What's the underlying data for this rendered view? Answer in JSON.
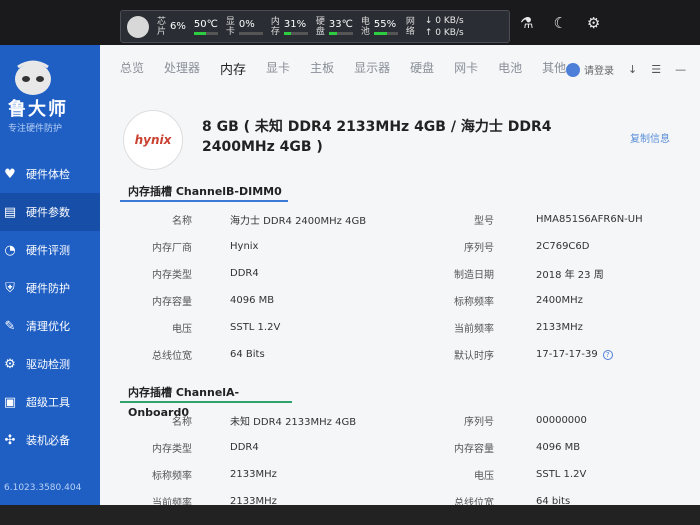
{
  "topbar": {
    "stats": [
      {
        "label_top": "芯",
        "label_bottom": "片",
        "value": "6%",
        "bar": 0.06
      },
      {
        "label_top": "",
        "label_bottom": "",
        "value": "50℃",
        "bar": 0.5
      },
      {
        "label_top": "显",
        "label_bottom": "卡",
        "value": "0%",
        "bar": 0.0
      },
      {
        "label_top": "内",
        "label_bottom": "存",
        "value": "31%",
        "bar": 0.31
      },
      {
        "label_top": "硬",
        "label_bottom": "盘",
        "value": "33℃",
        "bar": 0.33
      },
      {
        "label_top": "电",
        "label_bottom": "池",
        "value": "55%",
        "bar": 0.55
      }
    ],
    "net": {
      "label_top": "网",
      "label_bottom": "络",
      "down": "↓ 0 KB/s",
      "up": "↑ 0 KB/s"
    }
  },
  "top_icons": [
    "flask-icon",
    "moon-icon",
    "gear-icon"
  ],
  "sidebar": {
    "brand": "鲁大师",
    "slogan": "专注硬件防护",
    "items": [
      {
        "label": "硬件体检",
        "icon": "heart-icon"
      },
      {
        "label": "硬件参数",
        "icon": "list-icon"
      },
      {
        "label": "硬件评测",
        "icon": "gauge-icon"
      },
      {
        "label": "硬件防护",
        "icon": "shield-icon"
      },
      {
        "label": "清理优化",
        "icon": "broom-icon"
      },
      {
        "label": "驱动检测",
        "icon": "gear-icon"
      },
      {
        "label": "超级工具",
        "icon": "toolbox-icon"
      },
      {
        "label": "装机必备",
        "icon": "apps-icon"
      }
    ],
    "version": "6.1023.3580.404"
  },
  "tabs": [
    "总览",
    "处理器",
    "内存",
    "显卡",
    "主板",
    "显示器",
    "硬盘",
    "网卡",
    "电池",
    "其他"
  ],
  "active_tab": "内存",
  "tools": {
    "login": "请登录"
  },
  "memory": {
    "brand_logo": "hynix",
    "title": "8 GB ( 未知 DDR4 2133MHz 4GB / 海力士 DDR4 2400MHz 4GB )",
    "copy_label": "复制信息"
  },
  "slot_b": {
    "title": "内存插槽 ChannelB-DIMM0",
    "rows": [
      {
        "k1": "名称",
        "v1": "海力士 DDR4 2400MHz 4GB",
        "k2": "型号",
        "v2": "HMA851S6AFR6N-UH"
      },
      {
        "k1": "内存厂商",
        "v1": "Hynix",
        "k2": "序列号",
        "v2": "2C769C6D"
      },
      {
        "k1": "内存类型",
        "v1": "DDR4",
        "k2": "制造日期",
        "v2": "2018 年 23 周"
      },
      {
        "k1": "内存容量",
        "v1": "4096 MB",
        "k2": "标称频率",
        "v2": "2400MHz"
      },
      {
        "k1": "电压",
        "v1": "SSTL 1.2V",
        "k2": "当前频率",
        "v2": "2133MHz"
      },
      {
        "k1": "总线位宽",
        "v1": "64 Bits",
        "k2": "默认时序",
        "v2": "17-17-17-39"
      }
    ]
  },
  "slot_a": {
    "title": "内存插槽 ChannelA-Onboard0",
    "rows": [
      {
        "k1": "名称",
        "v1": "未知 DDR4 2133MHz 4GB",
        "k2": "序列号",
        "v2": "00000000"
      },
      {
        "k1": "内存类型",
        "v1": "DDR4",
        "k2": "内存容量",
        "v2": "4096 MB"
      },
      {
        "k1": "标称频率",
        "v1": "2133MHz",
        "k2": "电压",
        "v2": "SSTL 1.2V"
      },
      {
        "k1": "当前频率",
        "v1": "2133MHz",
        "k2": "总线位宽",
        "v2": "64 bits"
      }
    ]
  },
  "colors": {
    "sidebar": "#1f5fc4",
    "accent_blue": "#3b7ad6",
    "accent_green": "#2fa36b",
    "hynix_red": "#c94231"
  }
}
